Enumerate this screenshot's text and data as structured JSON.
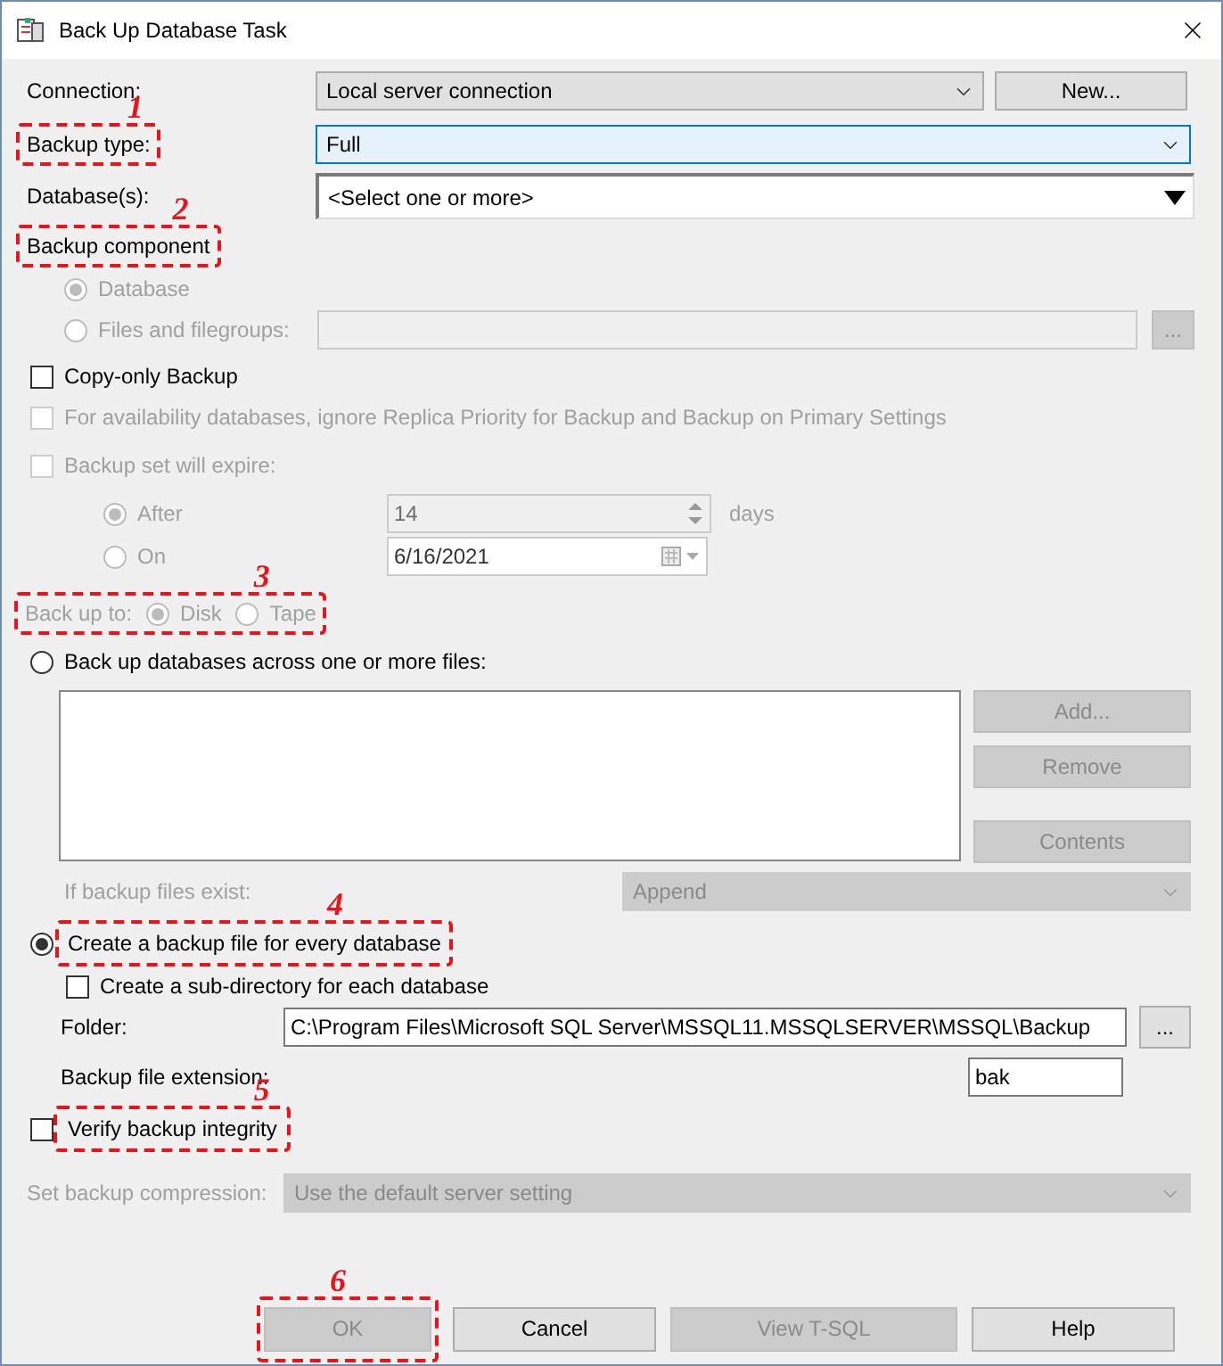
{
  "window": {
    "title": "Back Up Database Task"
  },
  "connection": {
    "label": "Connection:",
    "value": "Local server connection",
    "button": "New..."
  },
  "backup_type": {
    "label": "Backup type:",
    "value": "Full",
    "callout": "1"
  },
  "databases": {
    "label": "Database(s):",
    "value": "<Select one or more>"
  },
  "backup_component": {
    "label": "Backup component",
    "callout": "2",
    "disabled": true,
    "options": [
      {
        "label": "Database",
        "selected": true
      },
      {
        "label": "Files and filegroups:",
        "selected": false
      }
    ],
    "browse": "..."
  },
  "copy_only": {
    "label": "Copy-only Backup",
    "checked": false,
    "disabled": false
  },
  "availability": {
    "label": "For availability databases, ignore Replica Priority for Backup and Backup on Primary Settings",
    "checked": false,
    "disabled": true
  },
  "expire": {
    "label": "Backup set will expire:",
    "checked": false,
    "disabled": true,
    "after": {
      "label": "After",
      "selected": true,
      "value": "14",
      "unit": "days"
    },
    "on": {
      "label": "On",
      "selected": false,
      "value": "6/16/2021"
    }
  },
  "back_up_to": {
    "label": "Back up to:",
    "callout": "3",
    "disabled": true,
    "options": [
      {
        "label": "Disk",
        "selected": true
      },
      {
        "label": "Tape",
        "selected": false
      }
    ]
  },
  "across_files": {
    "label": "Back up databases across one or more files:",
    "selected": false,
    "buttons": [
      {
        "label": "Add...",
        "disabled": true
      },
      {
        "label": "Remove",
        "disabled": true
      },
      {
        "label": "Contents",
        "disabled": true
      }
    ],
    "if_exists": {
      "label": "If backup files exist:",
      "value": "Append",
      "disabled": true
    }
  },
  "every_database": {
    "label": "Create a backup file for every database",
    "selected": true,
    "callout": "4",
    "subdirectory": {
      "label": "Create a sub-directory for each database",
      "checked": false
    },
    "folder": {
      "label": "Folder:",
      "value": "C:\\Program Files\\Microsoft SQL Server\\MSSQL11.MSSQLSERVER\\MSSQL\\Backup",
      "button": "..."
    },
    "extension": {
      "label": "Backup file extension:",
      "value": "bak"
    }
  },
  "verify": {
    "label": "Verify backup integrity",
    "checked": false,
    "callout": "5"
  },
  "compression": {
    "label": "Set backup compression:",
    "value": "Use the default server setting",
    "disabled": true
  },
  "buttons": [
    {
      "label": "OK",
      "disabled": true,
      "callout": "6"
    },
    {
      "label": "Cancel",
      "disabled": false
    },
    {
      "label": "View T-SQL",
      "disabled": true
    },
    {
      "label": "Help",
      "disabled": false
    }
  ]
}
